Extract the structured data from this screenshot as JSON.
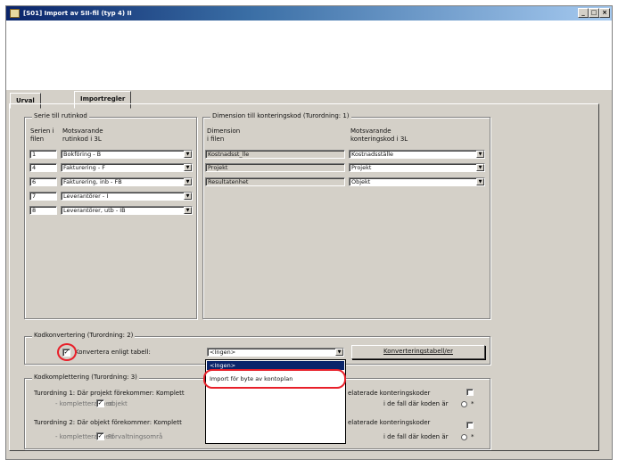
{
  "window": {
    "title": "[S01] Import av SII-fil (typ 4) II",
    "buttons": [
      "_",
      "□",
      "×"
    ]
  },
  "tabs": [
    {
      "label": "Urval",
      "active": false
    },
    {
      "label": "Importregler",
      "active": true
    }
  ],
  "series_group": {
    "legend": "Serie till rutinkod",
    "col1_header": "Serien i\nfilen",
    "col2_header": "Motsvarande\nrutinkod i 3L",
    "rows": [
      {
        "series": "1",
        "code": "Bokföring - B"
      },
      {
        "series": "4",
        "code": "Fakturering - F"
      },
      {
        "series": "6",
        "code": "Fakturering, inb - FB"
      },
      {
        "series": "7",
        "code": "Leverantörer - I"
      },
      {
        "series": "8",
        "code": "Leverantörer, utb - IB"
      }
    ]
  },
  "dimension_group": {
    "legend": "Dimension till konteringskod (Turordning: 1)",
    "col1_header": "Dimension\ni filen",
    "col2_header": "Motsvarande\nkonteringskod i 3L",
    "rows": [
      {
        "dimension": "Kostnadsst_lle",
        "code": "Kostnadsställe"
      },
      {
        "dimension": "Projekt",
        "code": "Projekt"
      },
      {
        "dimension": "Resultatenhet",
        "code": "Objekt"
      }
    ]
  },
  "conversion_group": {
    "legend": "Kodkonvertering (Turordning: 2)",
    "checkbox_label": "Konvertera enligt tabell:",
    "checkbox_checked": true,
    "select_value": "<Ingen>",
    "button_label": "Konverteringstabell/er"
  },
  "dropdown": {
    "options": [
      "<Ingen>",
      "Import för byte av kontoplan"
    ],
    "selected_index": 0
  },
  "completion_group": {
    "legend": "Kodkomplettering (Turordning: 3)",
    "rule1_prefix": "Turordning 1: Där projekt förekommer: Komplett",
    "rule1_suffix": "elaterade konteringskoder",
    "rule1_sub": "- komplettera med",
    "rule1_check": "objekt",
    "rule1_right": "i de fall där koden är",
    "rule2_prefix": "Turordning 2: Där objekt förekommer: Komplett",
    "rule2_suffix": "elaterade konteringskoder",
    "rule2_sub": "- komplettera med",
    "rule2_check": "Förvaltningsområ",
    "rule2_right": "i de fall där koden är",
    "radio_suffix": "*"
  },
  "colors": {
    "title_bar_start": "#0a246a",
    "title_bar_end": "#a6caf0",
    "highlight_ring": "#e8202a",
    "selection": "#0a246a"
  }
}
